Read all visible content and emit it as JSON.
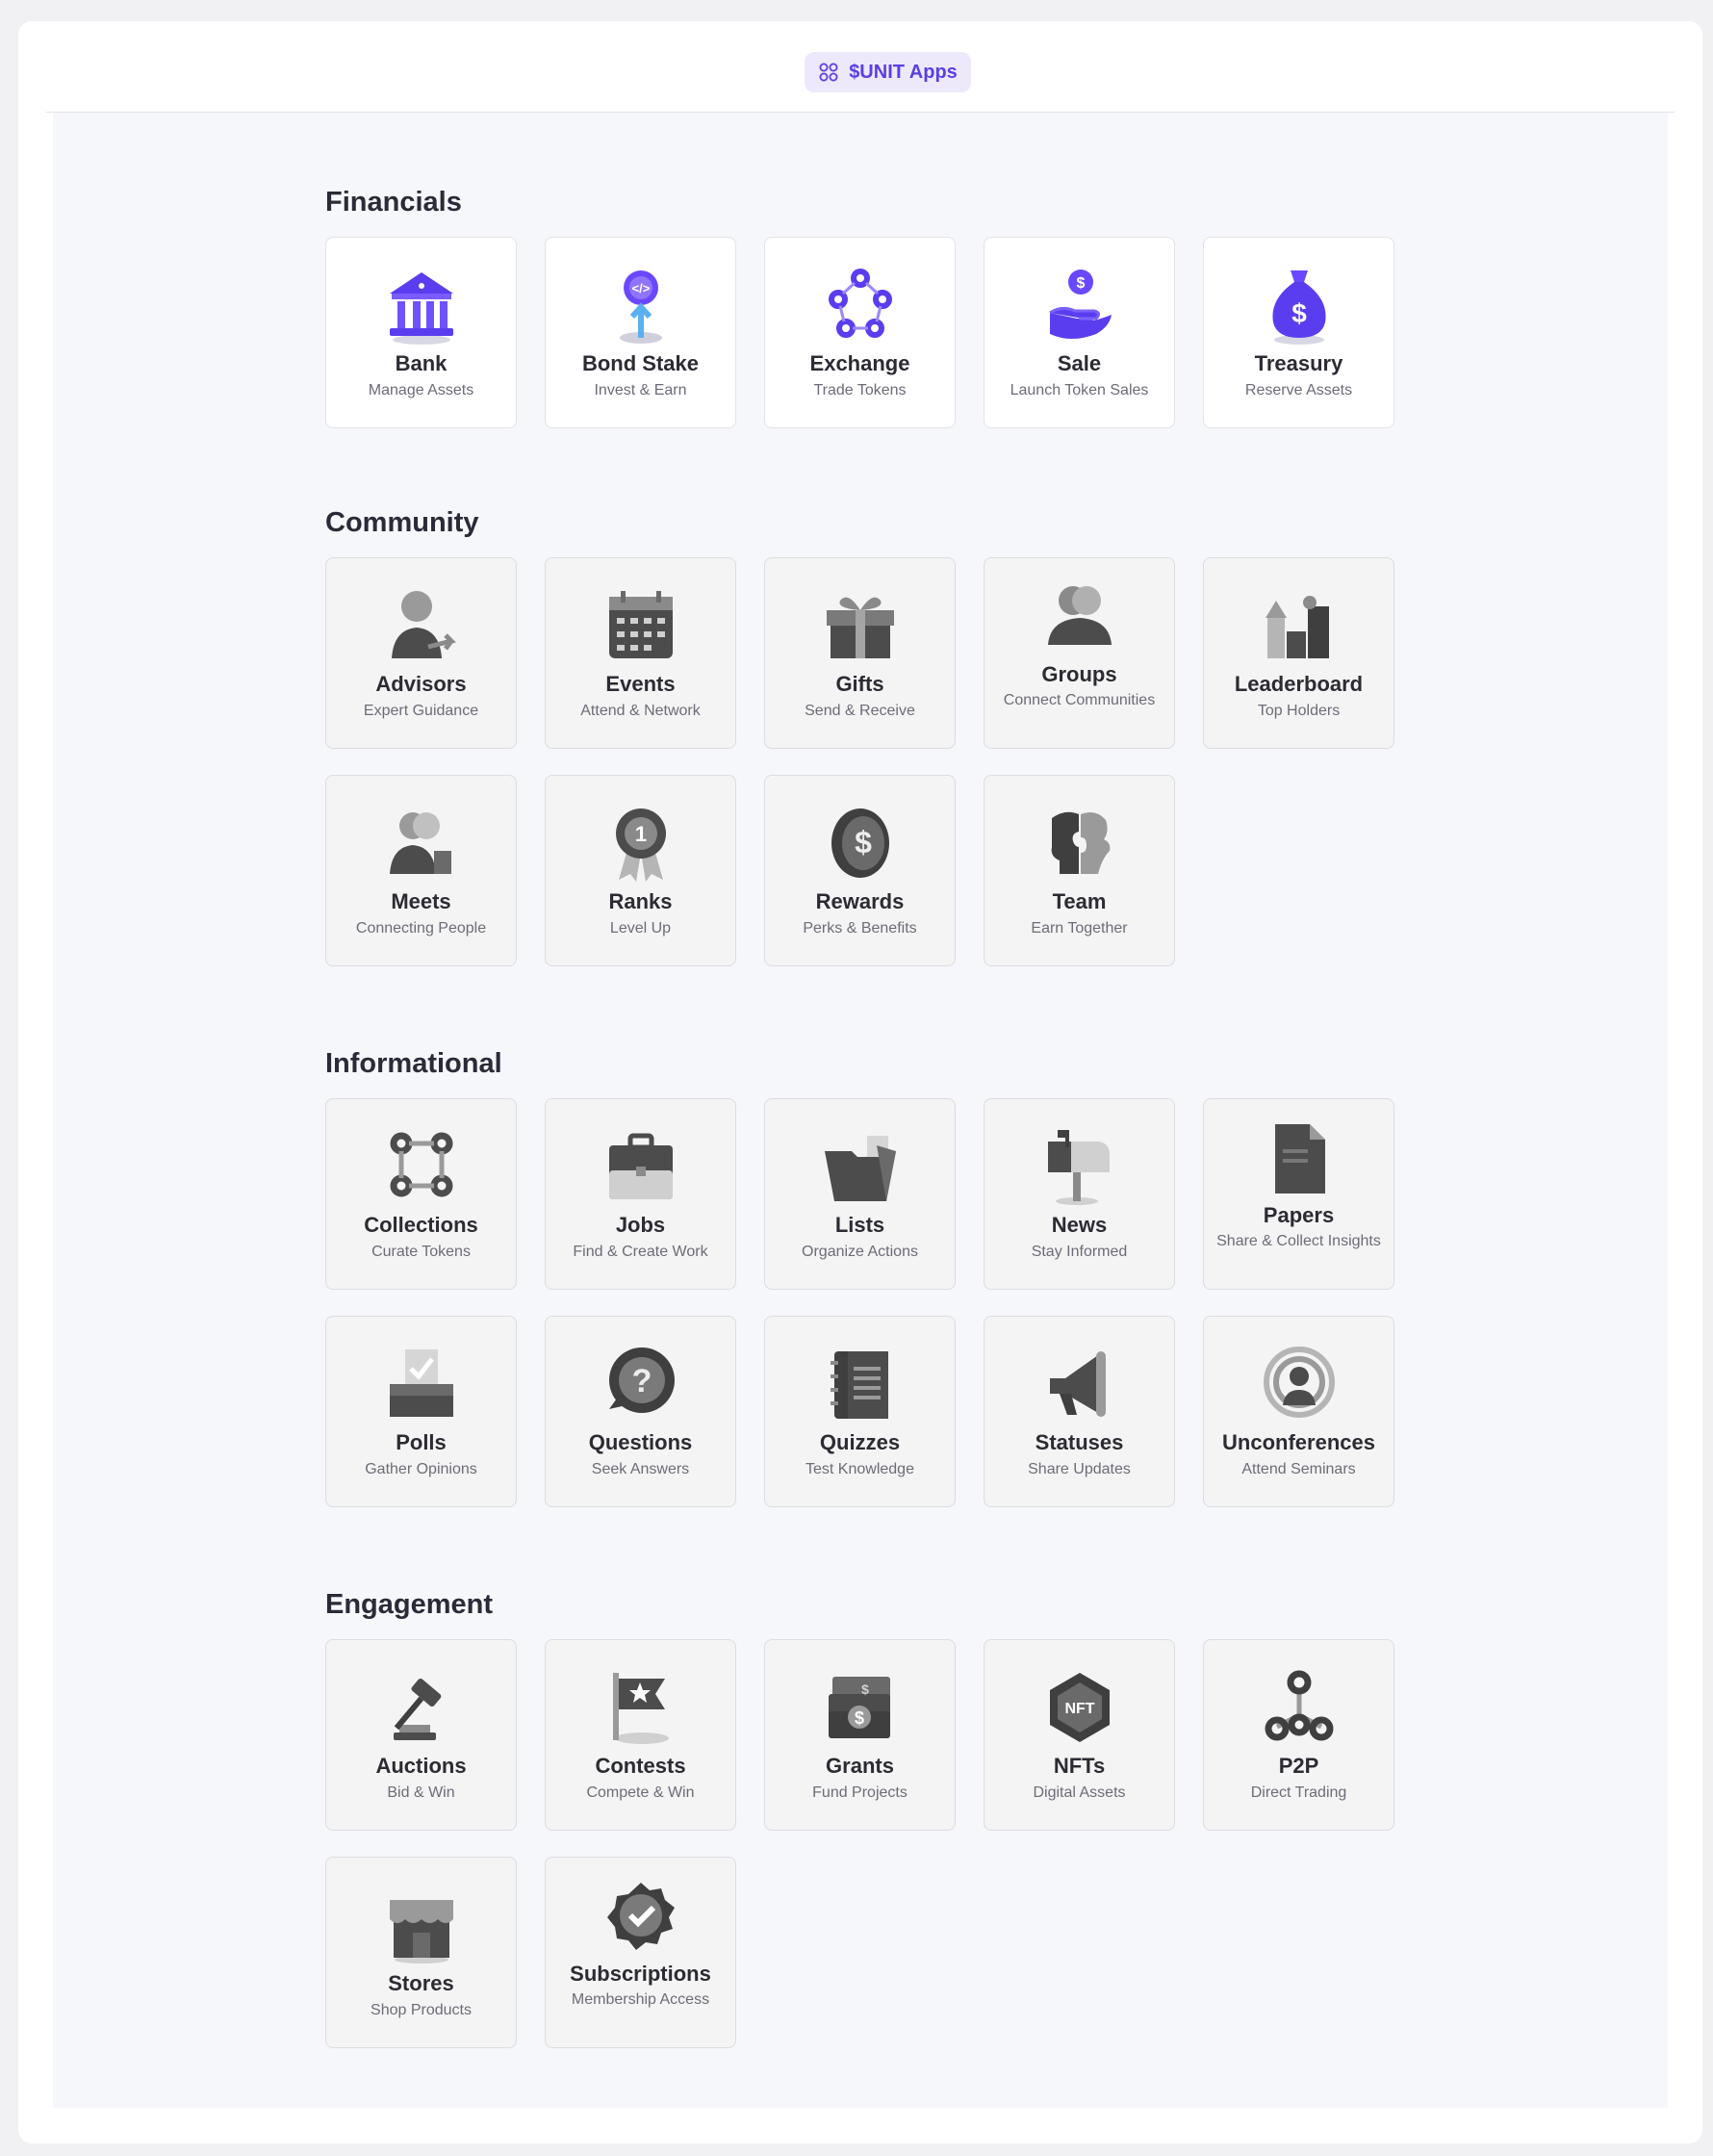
{
  "header": {
    "title": "$UNIT Apps",
    "icon": "grid-icon"
  },
  "sections": [
    {
      "title": "Financials",
      "apps": [
        {
          "label": "Bank",
          "sub": "Manage Assets",
          "icon": "bank-icon"
        },
        {
          "label": "Bond Stake",
          "sub": "Invest & Earn",
          "icon": "bond-stake-icon"
        },
        {
          "label": "Exchange",
          "sub": "Trade Tokens",
          "icon": "exchange-icon"
        },
        {
          "label": "Sale",
          "sub": "Launch Token Sales",
          "icon": "sale-icon"
        },
        {
          "label": "Treasury",
          "sub": "Reserve Assets",
          "icon": "money-bag-icon"
        }
      ]
    },
    {
      "title": "Community",
      "apps": [
        {
          "label": "Advisors",
          "sub": "Expert Guidance",
          "icon": "advisor-icon"
        },
        {
          "label": "Events",
          "sub": "Attend & Network",
          "icon": "calendar-icon"
        },
        {
          "label": "Gifts",
          "sub": "Send & Receive",
          "icon": "gift-icon"
        },
        {
          "label": "Groups",
          "sub": "Connect Communities",
          "icon": "group-icon"
        },
        {
          "label": "Leaderboard",
          "sub": "Top Holders",
          "icon": "leaderboard-icon"
        },
        {
          "label": "Meets",
          "sub": "Connecting People",
          "icon": "meets-icon"
        },
        {
          "label": "Ranks",
          "sub": "Level Up",
          "icon": "rank-badge-icon"
        },
        {
          "label": "Rewards",
          "sub": "Perks & Benefits",
          "icon": "coin-icon"
        },
        {
          "label": "Team",
          "sub": "Earn Together",
          "icon": "puzzle-team-icon"
        }
      ]
    },
    {
      "title": "Informational",
      "apps": [
        {
          "label": "Collections",
          "sub": "Curate Tokens",
          "icon": "collections-icon"
        },
        {
          "label": "Jobs",
          "sub": "Find & Create Work",
          "icon": "briefcase-icon"
        },
        {
          "label": "Lists",
          "sub": "Organize Actions",
          "icon": "folder-icon"
        },
        {
          "label": "News",
          "sub": "Stay Informed",
          "icon": "mailbox-icon"
        },
        {
          "label": "Papers",
          "sub": "Share & Collect Insights",
          "icon": "document-icon"
        },
        {
          "label": "Polls",
          "sub": "Gather Opinions",
          "icon": "ballot-icon"
        },
        {
          "label": "Questions",
          "sub": "Seek Answers",
          "icon": "question-icon"
        },
        {
          "label": "Quizzes",
          "sub": "Test Knowledge",
          "icon": "notebook-icon"
        },
        {
          "label": "Statuses",
          "sub": "Share Updates",
          "icon": "megaphone-icon"
        },
        {
          "label": "Unconferences",
          "sub": "Attend Seminars",
          "icon": "speaker-icon"
        }
      ]
    },
    {
      "title": "Engagement",
      "apps": [
        {
          "label": "Auctions",
          "sub": "Bid & Win",
          "icon": "gavel-icon"
        },
        {
          "label": "Contests",
          "sub": "Compete & Win",
          "icon": "flag-icon"
        },
        {
          "label": "Grants",
          "sub": "Fund Projects",
          "icon": "cash-icon"
        },
        {
          "label": "NFTs",
          "sub": "Digital Assets",
          "icon": "nft-icon"
        },
        {
          "label": "P2P",
          "sub": "Direct Trading",
          "icon": "p2p-icon"
        },
        {
          "label": "Stores",
          "sub": "Shop Products",
          "icon": "store-icon"
        },
        {
          "label": "Subscriptions",
          "sub": "Membership Access",
          "icon": "verified-badge-icon"
        }
      ]
    }
  ],
  "colors": {
    "accent": "#5a3fe0",
    "active_icon": "#5b3df0",
    "inactive_icon": "#5a5a5a"
  }
}
